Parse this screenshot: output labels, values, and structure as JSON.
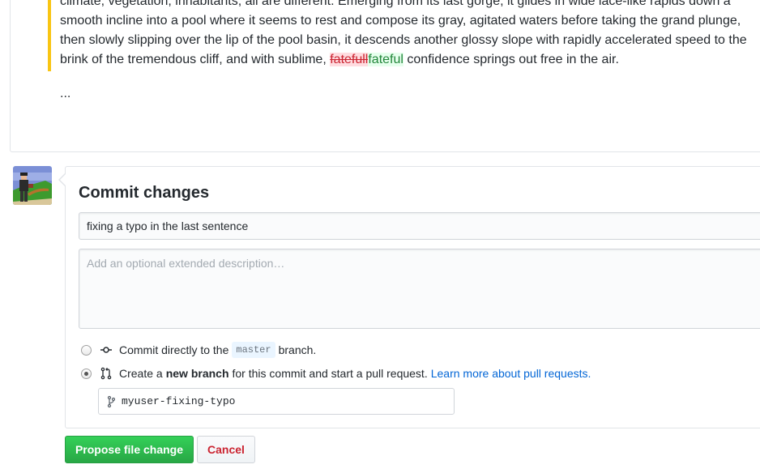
{
  "preview": {
    "line1": "climate, vegetation, inhabitants, all are different. Emerging from its last gorge, it glides in wide lace-like rapids down a",
    "line2": "smooth incline into a pool where it seems to rest and compose its gray, agitated waters before taking the grand plunge,",
    "line3": "then slowly slipping over the lip of the pool basin, it descends another glossy slope with rapidly accelerated speed to the",
    "line4_before": "brink of the tremendous cliff, and with sublime,",
    "deleted_word": "fatefull",
    "inserted_word": "fateful",
    "line4_after": "confidence springs out free in the air.",
    "ellipsis": "..."
  },
  "commit": {
    "title": "Commit changes",
    "summary_value": "fixing a typo in the last sentence",
    "description_placeholder": "Add an optional extended description…",
    "option_direct": {
      "before": "Commit directly to the",
      "branch": "master",
      "after": "branch.",
      "checked": false
    },
    "option_new_branch": {
      "before": "Create a",
      "bold": "new branch",
      "after": "for this commit and start a pull request.",
      "link": "Learn more about pull requests.",
      "checked": true
    },
    "branch_name": "myuser-fixing-typo"
  },
  "buttons": {
    "propose": "Propose file change",
    "cancel": "Cancel"
  },
  "colors": {
    "primary_green": "#28a745",
    "cancel_red": "#cb2431",
    "link_blue": "#0366d6",
    "quote_bar": "#f9c513"
  },
  "icons": {
    "commit": "git-commit-icon",
    "pull_request": "git-pull-request-icon",
    "branch": "git-branch-icon"
  }
}
